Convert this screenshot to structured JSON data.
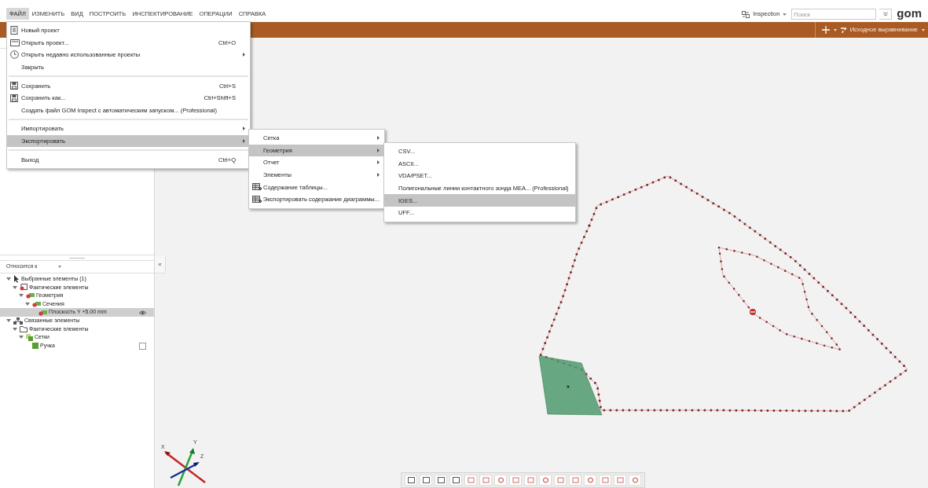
{
  "menubar": [
    {
      "label": "ФАЙЛ",
      "selected": true
    },
    {
      "label": "ИЗМЕНИТЬ",
      "selected": false
    },
    {
      "label": "ВИД",
      "selected": false
    },
    {
      "label": "ПОСТРОИТЬ",
      "selected": false
    },
    {
      "label": "ИНСПЕКТИРОВАНИЕ",
      "selected": false
    },
    {
      "label": "ОПЕРАЦИИ",
      "selected": false
    },
    {
      "label": "СПРАВКА",
      "selected": false
    }
  ],
  "header_right": {
    "workspace": "Inspection",
    "search": {
      "placeholder": "Поиск"
    },
    "logo": "gom"
  },
  "alignment": "Исходное выравнивание",
  "file_menu": [
    {
      "kind": "new",
      "label": "Новый проект",
      "selected": false
    },
    {
      "kind": "open",
      "label": "Открыть проект...",
      "shortcut": "Ctrl+O",
      "selected": false
    },
    {
      "kind": "recent",
      "label": "Открыть недавно использованные проекты",
      "submenu": true,
      "selected": false
    },
    {
      "kind": "item",
      "label": "Закрыть",
      "selected": false
    },
    {
      "kind": "separator"
    },
    {
      "kind": "save",
      "label": "Сохранить",
      "shortcut": "Ctrl+S",
      "selected": false
    },
    {
      "kind": "save",
      "label": "Сохранить как...",
      "shortcut": "Ctrl+Shift+S",
      "selected": false
    },
    {
      "kind": "item",
      "label": "Создать файл GOM Inspect с автоматическим запуском... (Professional)",
      "selected": false
    },
    {
      "kind": "separator"
    },
    {
      "kind": "item",
      "label": "Импортировать",
      "submenu": true,
      "selected": false
    },
    {
      "kind": "item",
      "label": "Экспортировать",
      "submenu": true,
      "selected": true
    },
    {
      "kind": "separator"
    },
    {
      "kind": "item",
      "label": "Выход",
      "shortcut": "Ctrl+Q",
      "selected": false
    }
  ],
  "export_menu": [
    {
      "kind": "item",
      "label": "Сетка",
      "submenu": true,
      "selected": false
    },
    {
      "kind": "item",
      "label": "Геометрия",
      "submenu": true,
      "selected": true
    },
    {
      "kind": "item",
      "label": "Отчет",
      "submenu": true,
      "selected": false
    },
    {
      "kind": "item",
      "label": "Элементы",
      "submenu": true,
      "selected": false
    },
    {
      "kind": "table",
      "label": "Содержание таблицы...",
      "selected": false
    },
    {
      "kind": "table",
      "label": "Экспортировать содержание диаграммы...",
      "selected": false
    }
  ],
  "geometry_menu": [
    {
      "kind": "item",
      "label": "CSV...",
      "selected": false
    },
    {
      "kind": "item",
      "label": "ASCII...",
      "selected": false
    },
    {
      "kind": "item",
      "label": "VDA/PSET...",
      "selected": false
    },
    {
      "kind": "item",
      "label": "Полигональные линии контактного зонда MEA... (Professional)",
      "selected": false
    },
    {
      "kind": "item",
      "label": "IGES...",
      "selected": true
    },
    {
      "kind": "item",
      "label": "UFF...",
      "selected": false
    }
  ],
  "relates_to": "Относится к",
  "collapse": "«",
  "tree": [
    {
      "kind": "cursor",
      "label": "Выбранные элементы (1)",
      "expanded": true,
      "selected": false,
      "children": [
        {
          "kind": "actual",
          "label": "Фактические элементы",
          "expanded": true,
          "selected": false,
          "children": [
            {
              "kind": "geometry",
              "label": "Геометрия",
              "expanded": true,
              "selected": false,
              "children": [
                {
                  "kind": "section",
                  "label": "Сечения",
                  "expanded": true,
                  "selected": false,
                  "children": [
                    {
                      "kind": "plane",
                      "label": "Плоскость Y +5.00 mm",
                      "selected": true,
                      "visible": true
                    }
                  ]
                }
              ]
            }
          ]
        }
      ]
    },
    {
      "kind": "linked",
      "label": "Связанные элементы",
      "expanded": true,
      "selected": false,
      "children": [
        {
          "kind": "folder",
          "label": "Фактические элементы",
          "expanded": true,
          "selected": false,
          "children": [
            {
              "kind": "meshes",
              "label": "Сетки",
              "expanded": true,
              "selected": false,
              "children": [
                {
                  "kind": "mesh",
                  "label": "Ручка",
                  "selected": false,
                  "checked": false
                }
              ]
            }
          ]
        }
      ]
    }
  ],
  "axes": {
    "x": "X",
    "y": "Y",
    "z": "Z"
  }
}
